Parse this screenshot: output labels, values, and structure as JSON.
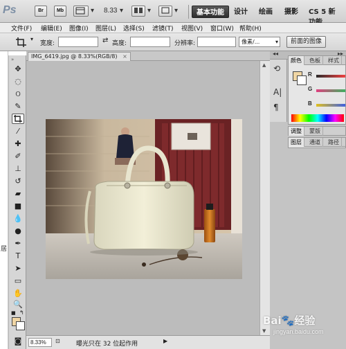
{
  "appbar": {
    "logo": "Ps",
    "br_btn": "Br",
    "mb_btn": "Mb",
    "zoom": "8.33",
    "workspaces": [
      "基本功能",
      "设计",
      "绘画",
      "摄影",
      "CS 5 新功能"
    ]
  },
  "menu": [
    "文件(F)",
    "编辑(E)",
    "图像(I)",
    "图层(L)",
    "选择(S)",
    "滤镜(T)",
    "视图(V)",
    "窗口(W)",
    "帮助(H)"
  ],
  "options": {
    "width_label": "宽度:",
    "height_label": "高度:",
    "resolution_label": "分辨率:",
    "unit_value": "像素/...",
    "front_image_button": "前面的图像"
  },
  "document": {
    "tab_title": "IMG_6419.jpg @ 8.33%(RGB/8)",
    "tab_close": "×",
    "zoom_value": "8.33%",
    "status_text": "曝光只在 32 位起作用"
  },
  "panels": {
    "color_tabs": [
      "颜色",
      "色板",
      "样式"
    ],
    "slider_letters": [
      "R",
      "G",
      "B"
    ],
    "adjust_tabs": [
      "调整",
      "蒙版"
    ],
    "layers_tabs": [
      "图层",
      "通道",
      "路径"
    ]
  },
  "colors": {
    "foreground": "#f0d6a4",
    "background": "#ffffff",
    "workspace_active": "#333333"
  },
  "watermark": {
    "main": "Bai🐾经验",
    "sub": "jingyan.baidu.com"
  },
  "left_edge_text": "居"
}
